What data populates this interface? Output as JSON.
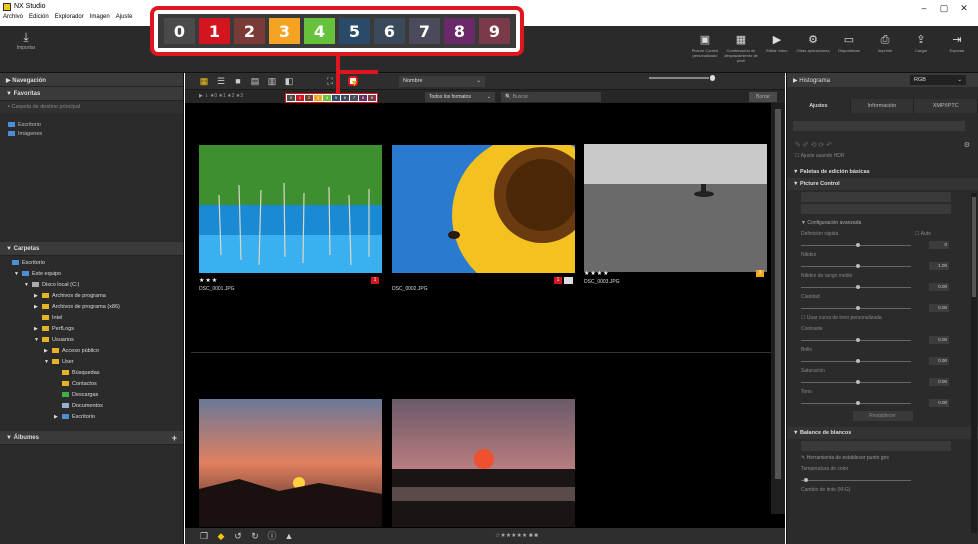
{
  "window": {
    "title": "NX Studio",
    "controls": [
      "–",
      "▢",
      "✕"
    ]
  },
  "menu": [
    "Archivo",
    "Edición",
    "Explorador",
    "Imagen",
    "Ajuste"
  ],
  "toolbar": {
    "import_label": "Importar",
    "right_items": [
      {
        "icon": "▣",
        "label": "Picture Control personalizado"
      },
      {
        "icon": "▦",
        "label": "Combinación de desplazamiento de píxel"
      },
      {
        "icon": "▶",
        "label": "Editar vídeo"
      },
      {
        "icon": "⚙",
        "label": "Otras aplicaciones"
      },
      {
        "icon": "▭",
        "label": "Diapositivas"
      },
      {
        "icon": "⎙",
        "label": "Imprimir"
      },
      {
        "icon": "⇪",
        "label": "Cargar"
      },
      {
        "icon": "⇥",
        "label": "Exportar"
      }
    ]
  },
  "color_labels": [
    {
      "num": "0",
      "color": "#4a4a4a"
    },
    {
      "num": "1",
      "color": "#d3151f"
    },
    {
      "num": "2",
      "color": "#7a3a36"
    },
    {
      "num": "3",
      "color": "#f4a422"
    },
    {
      "num": "4",
      "color": "#66c23a"
    },
    {
      "num": "5",
      "color": "#2a4a6a"
    },
    {
      "num": "6",
      "color": "#3a4a5a"
    },
    {
      "num": "7",
      "color": "#4a4a5a"
    },
    {
      "num": "8",
      "color": "#6a2a6a"
    },
    {
      "num": "9",
      "color": "#7a3a4a"
    }
  ],
  "left": {
    "navigation": "Navegación",
    "favorites": "Favoritas",
    "fav_placeholder": "Carpeta de destino principal",
    "fav_items": [
      "Escritorio",
      "Imágenes"
    ],
    "folders_header": "Carpetas",
    "tree": [
      {
        "label": "Escritorio",
        "indent": 0,
        "arrow": "",
        "color": "blue"
      },
      {
        "label": "Este equipo",
        "indent": 1,
        "arrow": "▼",
        "color": "blue"
      },
      {
        "label": "Disco local (C:)",
        "indent": 2,
        "arrow": "▼",
        "color": "disk"
      },
      {
        "label": "Archivos de programa",
        "indent": 3,
        "arrow": "▶",
        "color": "yellow"
      },
      {
        "label": "Archivos de programa (x86)",
        "indent": 3,
        "arrow": "▶",
        "color": "yellow"
      },
      {
        "label": "Intel",
        "indent": 3,
        "arrow": "",
        "color": "yellow"
      },
      {
        "label": "PerfLogs",
        "indent": 3,
        "arrow": "▶",
        "color": "yellow"
      },
      {
        "label": "Usuarios",
        "indent": 3,
        "arrow": "▼",
        "color": "yellow"
      },
      {
        "label": "Acceso público",
        "indent": 4,
        "arrow": "▶",
        "color": "yellow"
      },
      {
        "label": "User",
        "indent": 4,
        "arrow": "▼",
        "color": "yellow"
      },
      {
        "label": "Búsquedas",
        "indent": 5,
        "arrow": "",
        "color": "yellow"
      },
      {
        "label": "Contactos",
        "indent": 5,
        "arrow": "",
        "color": "yellow"
      },
      {
        "label": "Descargas",
        "indent": 5,
        "arrow": "",
        "color": "green"
      },
      {
        "label": "Documentos",
        "indent": 5,
        "arrow": "",
        "color": "doc"
      },
      {
        "label": "Escritorio",
        "indent": 5,
        "arrow": "▶",
        "color": "blue"
      }
    ],
    "albums": "Álbumes"
  },
  "center": {
    "sort_label": "Nombre",
    "formats_label": "Todos los formatos",
    "search_placeholder": "Buscar",
    "clear_label": "Borrar",
    "thumbs": [
      {
        "name": "DSC_0001.JPG",
        "stars": "★★★",
        "label": "1",
        "label_color": "#d3151f"
      },
      {
        "name": "DSC_0002.JPG",
        "stars": "",
        "label": "1",
        "label_color": "#d3151f"
      },
      {
        "name": "DSC_0003.JPG",
        "stars": "★★★★",
        "label": "3",
        "label_color": "#f4a422"
      },
      {
        "name": "",
        "stars": "",
        "label": "",
        "label_color": ""
      },
      {
        "name": "",
        "stars": "",
        "label": "",
        "label_color": ""
      }
    ]
  },
  "right": {
    "histogram": "Histograma",
    "rgb": "RGB",
    "tabs": [
      "Ajustes",
      "Información",
      "XMP/IPTC"
    ],
    "hdr": "Ajuste usando HDR",
    "section_basic": "Paletas de edición básicas",
    "picture_control": "Picture Control",
    "advanced": "Configuración avanzada",
    "quick": "Definición rápida",
    "auto": "Auto",
    "sliders": [
      {
        "label": "Nitidez",
        "value": "1.00"
      },
      {
        "label": "Nitidez de rango medio",
        "value": "0.00"
      },
      {
        "label": "Claridad",
        "value": "0.00"
      }
    ],
    "tone_curve": "Usar curva de tono personalizada",
    "sliders2": [
      {
        "label": "Contraste",
        "value": "0.00"
      },
      {
        "label": "Brillo",
        "value": "0.00"
      },
      {
        "label": "Saturación",
        "value": "0.00"
      },
      {
        "label": "Tono",
        "value": "0.00"
      }
    ],
    "reset": "Restablecer",
    "wb": "Balance de blancos",
    "gray_point": "Herramienta de establecer punto gris",
    "color_temp": "Temperatura de color",
    "tint": "Cambio de tinte (M-G)"
  }
}
